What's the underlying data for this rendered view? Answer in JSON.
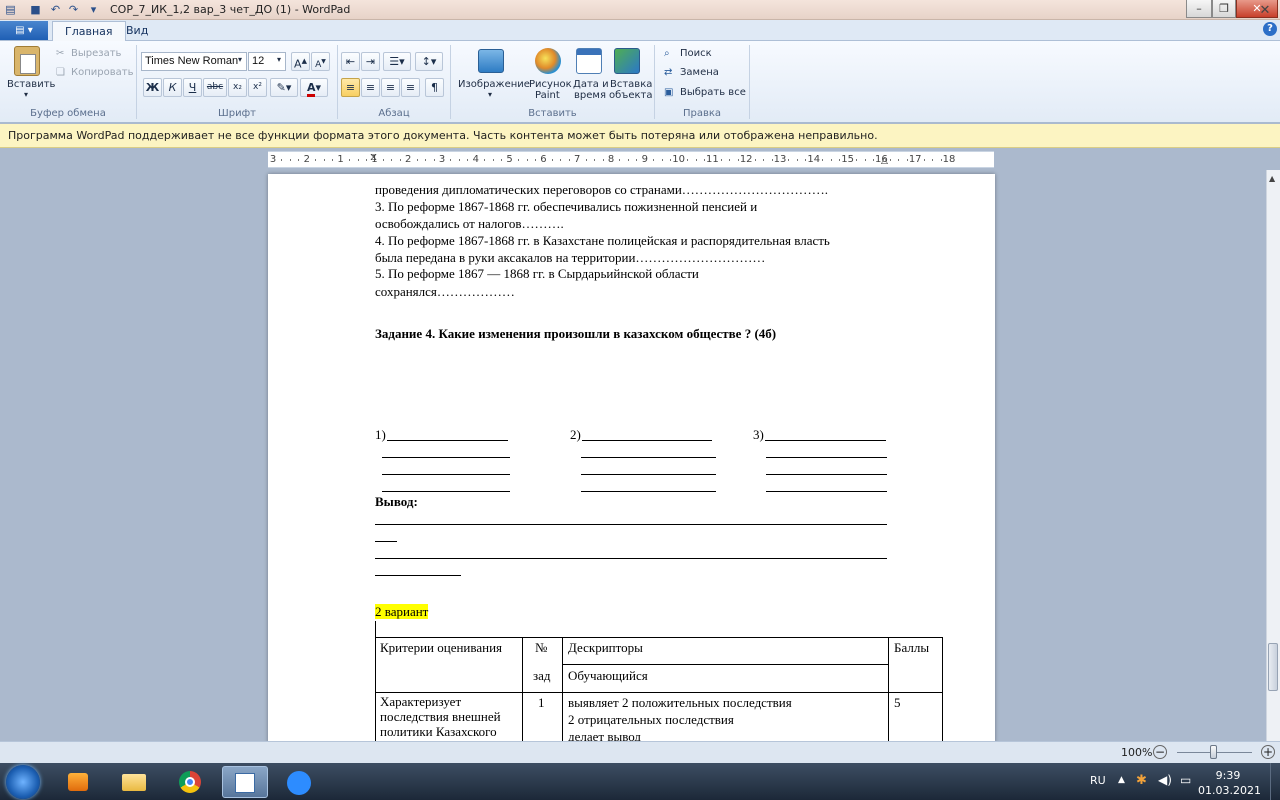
{
  "window": {
    "title": "СОР_7_ИК_1,2 вар_3 чет_ДО (1) - WordPad"
  },
  "tabs": {
    "home": "Главная",
    "view": "Вид"
  },
  "clipboard": {
    "paste": "Вставить",
    "cut": "Вырезать",
    "copy": "Копировать",
    "group": "Буфер обмена"
  },
  "font": {
    "family": "Times New Roman",
    "size": "12",
    "group": "Шрифт",
    "bold": "Ж",
    "italic": "К",
    "underline": "Ч",
    "strike": "abc"
  },
  "paragraph": {
    "group": "Абзац"
  },
  "insert": {
    "image": "Изображение",
    "paint_l1": "Рисунок",
    "paint_l2": "Paint",
    "date_l1": "Дата и",
    "date_l2": "время",
    "object_l1": "Вставка",
    "object_l2": "объекта",
    "group": "Вставить"
  },
  "editing": {
    "find": "Поиск",
    "replace": "Замена",
    "select_all": "Выбрать все",
    "group": "Правка"
  },
  "notification": {
    "message": "Программа WordPad поддерживает не все функции формата этого документа. Часть контента может быть потеряна или отображена неправильно."
  },
  "ruler": {
    "labels": [
      "3",
      "2",
      "1",
      "1",
      "2",
      "3",
      "4",
      "5",
      "6",
      "7",
      "8",
      "9",
      "10",
      "11",
      "12",
      "13",
      "14",
      "15",
      "16",
      "17",
      "18"
    ]
  },
  "document": {
    "lines": [
      "проведения дипломатических переговоров со странами…………………………….",
      "3. По реформе 1867-1868 гг. обеспечивались пожизненной пенсией и",
      "освобождались от налогов……….",
      "4. По реформе 1867-1868 гг. в Казахстане полицейская и распорядительная власть",
      "была передана в руки аксакалов на территории…………………………",
      "5. По реформе 1867 — 1868 гг. в Сырдарьийнской области",
      "сохранялся………………"
    ],
    "task4": "Задание 4. Какие изменения произошли в казахском обществе ? (4б)",
    "col1": "1)",
    "col2": "2)",
    "col3": "3)",
    "conclusion": "Вывод:",
    "variant": "2 вариант",
    "table": {
      "h_criteria": "Критерии оценивания",
      "h_num_1": "№",
      "h_num_2": "зад",
      "h_desc": "Дескрипторы",
      "h_points": "Баллы",
      "h_learner": "Обучающийся",
      "r1_criteria": [
        "Характеризует",
        "последствия внешней",
        "политики Казахского"
      ],
      "r1_num": "1",
      "r1_desc": [
        "выявляет 2 положительных последствия",
        "2 отрицательных последствия",
        "делает вывод"
      ],
      "r1_points": "5"
    }
  },
  "status": {
    "zoom": "100%"
  },
  "taskbar": {
    "lang": "RU",
    "time": "9:39",
    "date": "01.03.2021"
  }
}
